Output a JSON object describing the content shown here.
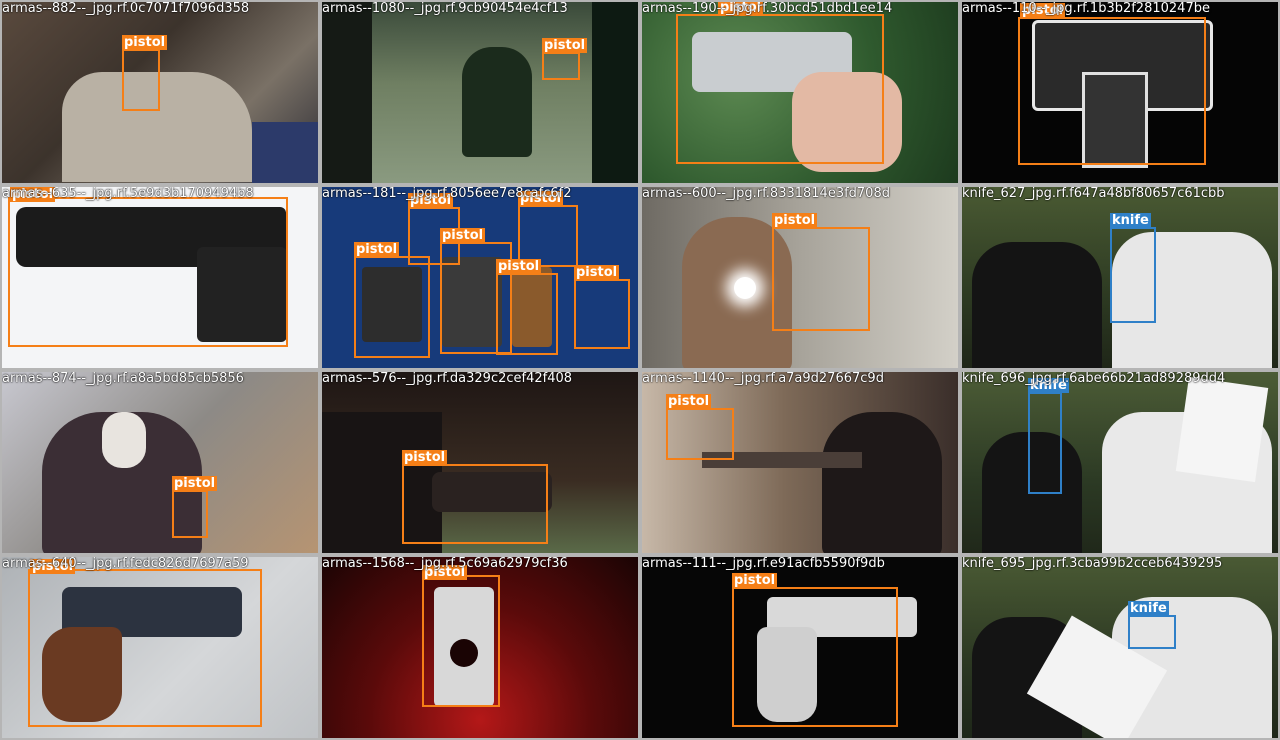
{
  "labels": {
    "pistol": "pistol",
    "knife": "knife"
  },
  "colors": {
    "pistol": "#f57f17",
    "knife": "#2f80c8",
    "divider": "#b5b5b5"
  },
  "tiles": [
    {
      "file": "armas--882--_jpg.rf.0c7071f7096d358",
      "detections": [
        "pistol"
      ]
    },
    {
      "file": "armas--1080--_jpg.rf.9cb90454e4cf13",
      "detections": [
        "pistol"
      ]
    },
    {
      "file": "armas--190--_jpg.rf.30bcd51dbd1ee14",
      "detections": [
        "pistol"
      ]
    },
    {
      "file": "armas--110--_jpg.rf.1b3b2f2810247be",
      "detections": [
        "pistol"
      ]
    },
    {
      "file": "armas--635--_jpg.rf.5e9d3b1709494b8",
      "detections": [
        "pistol"
      ]
    },
    {
      "file": "armas--181--_jpg.rf.8056ee7e8cafc6f2",
      "detections": [
        "pistol",
        "pistol",
        "pistol",
        "pistol",
        "pistol",
        "pistol"
      ]
    },
    {
      "file": "armas--600--_jpg.rf.8331814e3fd708d",
      "detections": [
        "pistol"
      ]
    },
    {
      "file": "knife_627_jpg.rf.f647a48bf80657c61cbb",
      "detections": [
        "knife"
      ]
    },
    {
      "file": "armas--874--_jpg.rf.a8a5bd85cb5856",
      "detections": [
        "pistol"
      ]
    },
    {
      "file": "armas--576--_jpg.rf.da329c2cef42f408",
      "detections": [
        "pistol"
      ]
    },
    {
      "file": "armas--1140--_jpg.rf.a7a9d27667c9d",
      "detections": [
        "pistol"
      ]
    },
    {
      "file": "knife_696_jpg.rf.6abe66b21ad89289dd4",
      "detections": [
        "knife"
      ]
    },
    {
      "file": "armas--640--_jpg.rf.fedc826d7697a59",
      "detections": [
        "pistol"
      ]
    },
    {
      "file": "armas--1568--_jpg.rf.5c69a62979cf36",
      "detections": [
        "pistol"
      ]
    },
    {
      "file": "armas--111--_jpg.rf.e91acfb5590f9db",
      "detections": [
        "pistol"
      ]
    },
    {
      "file": "knife_695_jpg.rf.3cba99b2cceb6439295",
      "detections": [
        "knife"
      ]
    }
  ]
}
